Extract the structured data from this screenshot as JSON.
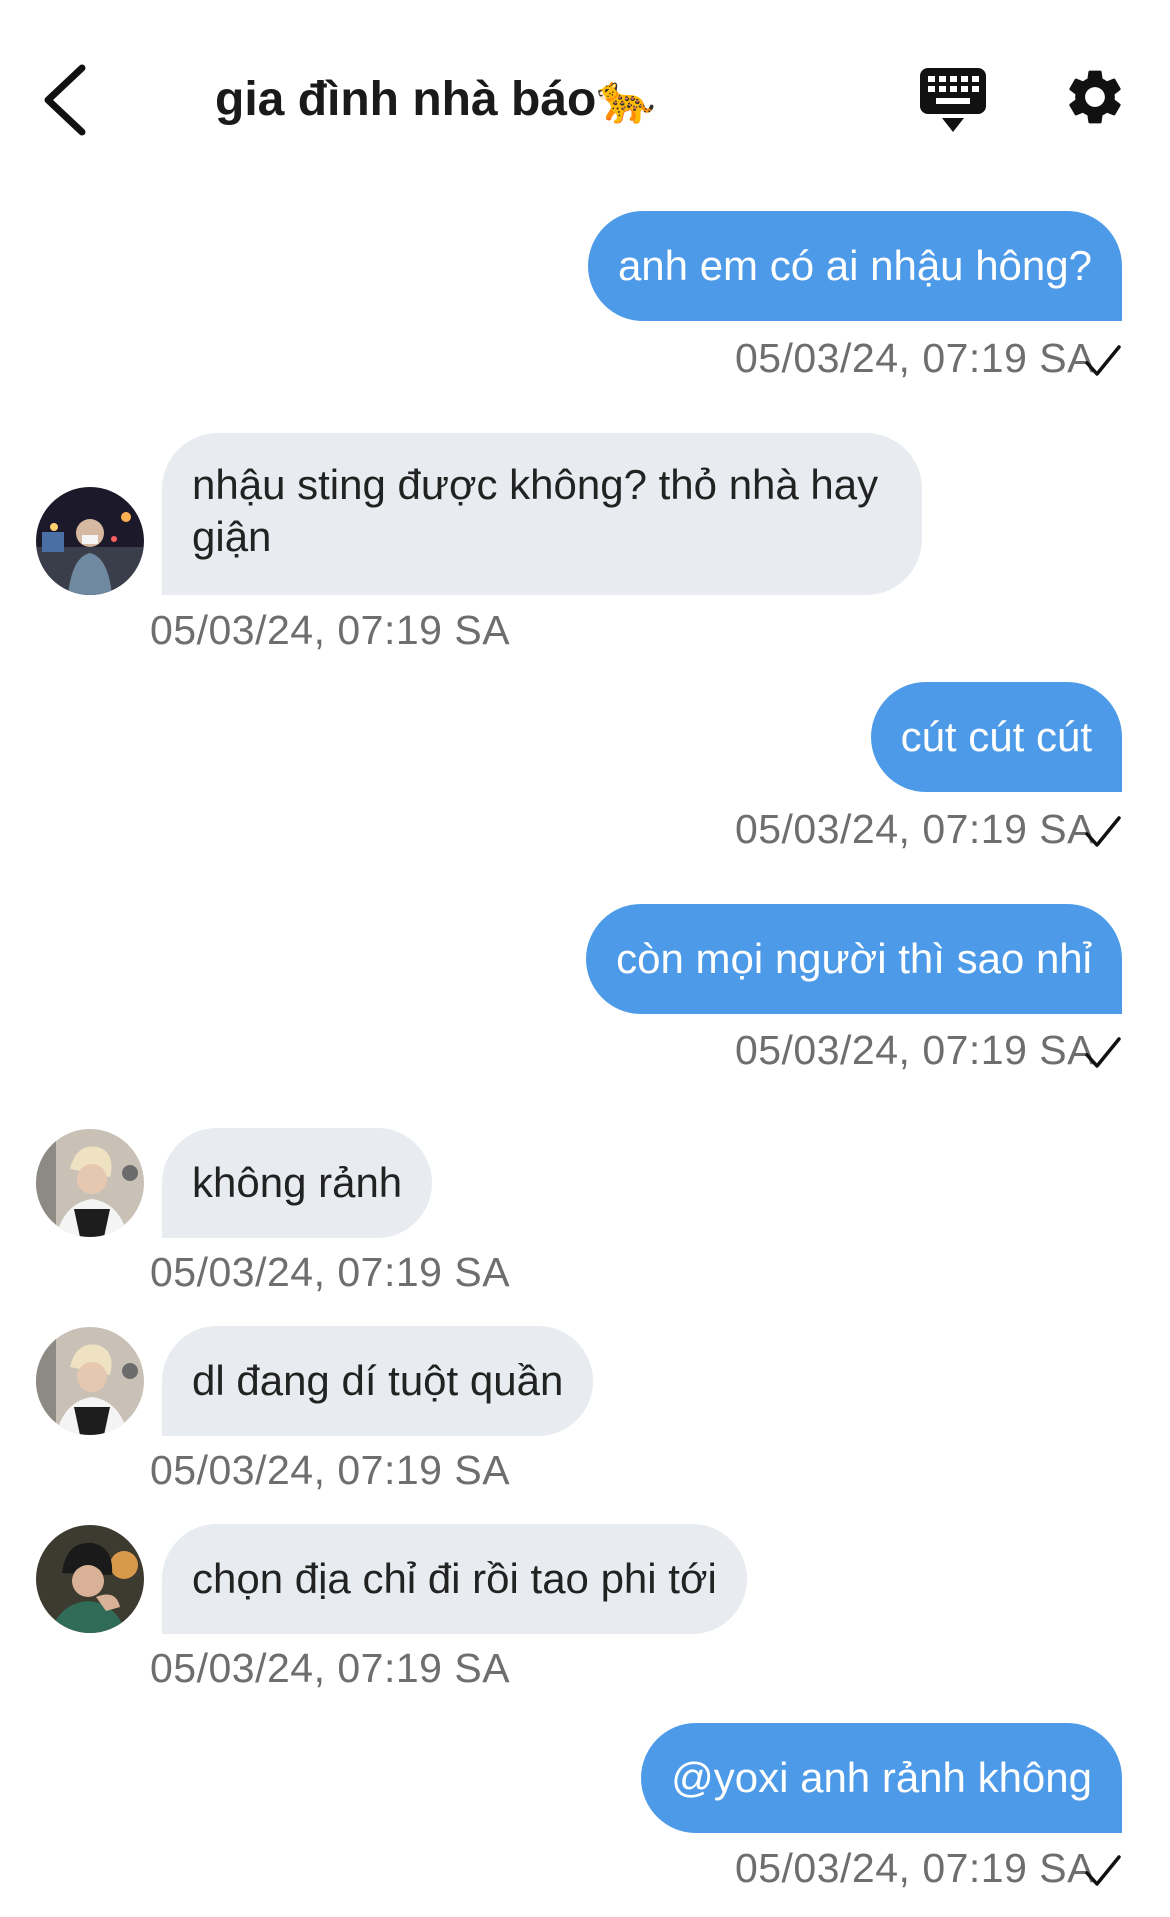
{
  "header": {
    "title": "gia đình nhà báo🐆",
    "back_icon": "chevron-left-icon",
    "keyboard_icon": "keyboard-icon",
    "settings_icon": "gear-icon"
  },
  "colors": {
    "outgoing_bubble": "#4d9be8",
    "incoming_bubble": "#e8ebef",
    "timestamp": "#6e6e6e"
  },
  "messages": [
    {
      "direction": "out",
      "text": "anh em có ai nhậu hông?",
      "time": "05/03/24, 07:19 SA",
      "status_icon": "checkmark-icon"
    },
    {
      "direction": "in",
      "text": "nhậu sting được không? thỏ nhà hay giận",
      "time": "05/03/24, 07:19 SA",
      "avatar": "avatar-1"
    },
    {
      "direction": "out",
      "text": "cút cút cút",
      "time": "05/03/24, 07:19 SA",
      "status_icon": "checkmark-icon"
    },
    {
      "direction": "out",
      "text": "còn mọi người thì sao nhỉ",
      "time": "05/03/24, 07:19 SA",
      "status_icon": "checkmark-icon"
    },
    {
      "direction": "in",
      "text": "không rảnh",
      "time": "05/03/24, 07:19 SA",
      "avatar": "avatar-2"
    },
    {
      "direction": "in",
      "text": "dl đang dí tuột quần",
      "time": "05/03/24, 07:19 SA",
      "avatar": "avatar-2"
    },
    {
      "direction": "in",
      "text": "chọn địa chỉ đi rồi tao phi tới",
      "time": "05/03/24, 07:19 SA",
      "avatar": "avatar-3"
    },
    {
      "direction": "out",
      "text": "@yoxi anh rảnh không",
      "time": "05/03/24, 07:19 SA",
      "status_icon": "checkmark-icon"
    }
  ]
}
